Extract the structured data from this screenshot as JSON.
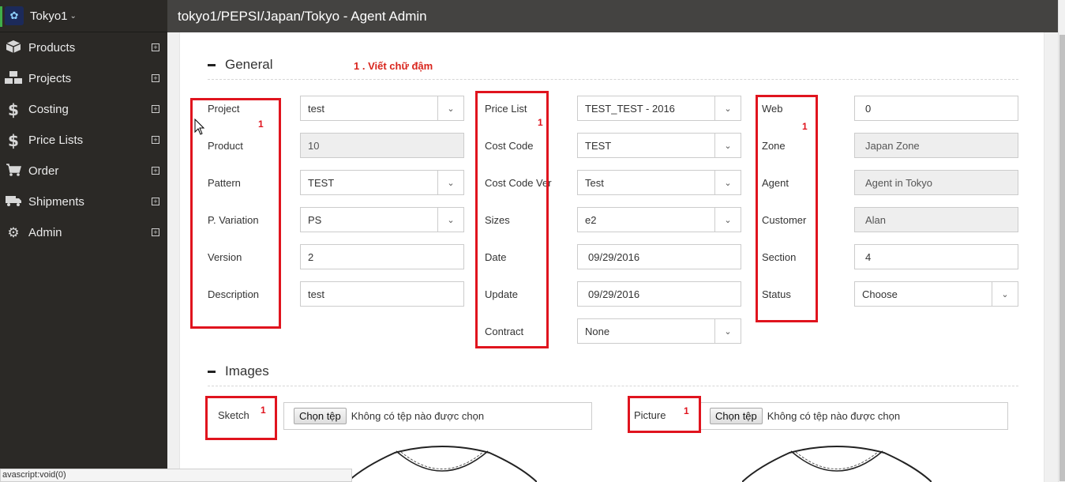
{
  "brand": {
    "name": "Tokyo1",
    "caret": "⌄"
  },
  "sidebar": {
    "items": [
      {
        "label": "Products",
        "icon": "box-icon"
      },
      {
        "label": "Projects",
        "icon": "boxes-icon"
      },
      {
        "label": "Costing",
        "icon": "dollar-icon"
      },
      {
        "label": "Price Lists",
        "icon": "dollar-icon"
      },
      {
        "label": "Order",
        "icon": "cart-icon"
      },
      {
        "label": "Shipments",
        "icon": "truck-icon"
      },
      {
        "label": "Admin",
        "icon": "gears-icon"
      }
    ]
  },
  "header": {
    "title": "tokyo1/PEPSI/Japan/Tokyo - Agent Admin"
  },
  "general": {
    "title": "General",
    "note": "1 . Viết chữ đậm",
    "col1": [
      {
        "label": "Project",
        "value": "test",
        "kind": "select"
      },
      {
        "label": "Product",
        "value": "10",
        "kind": "readonly"
      },
      {
        "label": "Pattern",
        "value": "TEST",
        "kind": "select"
      },
      {
        "label": "P. Variation",
        "value": "PS",
        "kind": "select"
      },
      {
        "label": "Version",
        "value": "2",
        "kind": "input"
      },
      {
        "label": "Description",
        "value": "test",
        "kind": "input"
      }
    ],
    "col2": [
      {
        "label": "Price List",
        "value": "TEST_TEST - 2016",
        "kind": "select"
      },
      {
        "label": "Cost Code",
        "value": "TEST",
        "kind": "select"
      },
      {
        "label": "Cost Code Ver",
        "value": "Test",
        "kind": "select"
      },
      {
        "label": "Sizes",
        "value": "e2",
        "kind": "select"
      },
      {
        "label": "Date",
        "value": "09/29/2016",
        "kind": "input"
      },
      {
        "label": "Update",
        "value": "09/29/2016",
        "kind": "input"
      },
      {
        "label": "Contract",
        "value": "None",
        "kind": "select"
      }
    ],
    "col3": [
      {
        "label": "Web",
        "value": "0",
        "kind": "input"
      },
      {
        "label": "Zone",
        "value": "Japan Zone",
        "kind": "readonly"
      },
      {
        "label": "Agent",
        "value": "Agent in Tokyo",
        "kind": "readonly"
      },
      {
        "label": "Customer",
        "value": "Alan",
        "kind": "readonly"
      },
      {
        "label": "Section",
        "value": "4",
        "kind": "input"
      },
      {
        "label": "Status",
        "value": "Choose",
        "kind": "select"
      }
    ],
    "marker": "1"
  },
  "images": {
    "title": "Images",
    "sketch_label": "Sketch",
    "picture_label": "Picture",
    "file_button": "Chọn tệp",
    "file_text": "Không có tệp nào được chọn",
    "marker": "1"
  },
  "statusbar": {
    "url": "avascript:void(0)"
  },
  "colors": {
    "accent_red": "#e0141e",
    "sidebar_bg": "#2b2926",
    "topbar_bg": "#444341"
  }
}
